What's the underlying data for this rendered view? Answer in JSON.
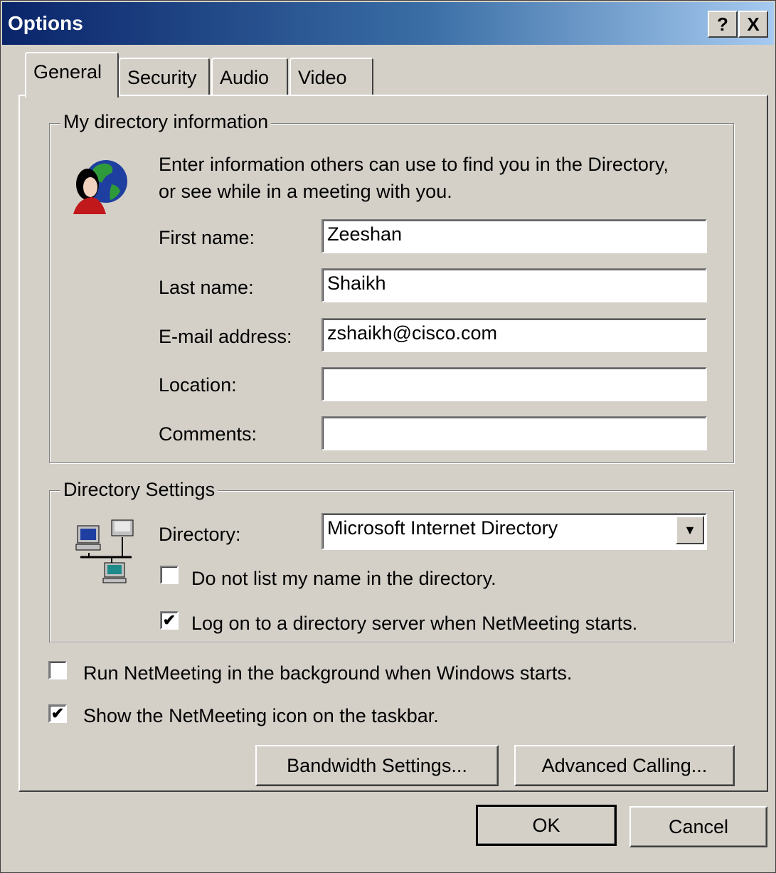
{
  "window": {
    "title": "Options",
    "help_button": "?",
    "close_button": "X"
  },
  "tabs": [
    {
      "label": "General"
    },
    {
      "label": "Security"
    },
    {
      "label": "Audio"
    },
    {
      "label": "Video"
    }
  ],
  "directory_info": {
    "legend": "My directory information",
    "intro_line1": "Enter information others can use to find you in the Directory,",
    "intro_line2": "or see while in a meeting with you.",
    "fields": [
      {
        "label": "First name:",
        "value": "Zeeshan"
      },
      {
        "label": "Last name:",
        "value": "Shaikh"
      },
      {
        "label": "E-mail address:",
        "value": "zshaikh@cisco.com"
      },
      {
        "label": "Location:",
        "value": ""
      },
      {
        "label": "Comments:",
        "value": ""
      }
    ]
  },
  "directory_settings": {
    "legend": "Directory Settings",
    "directory_label": "Directory:",
    "directory_value": "Microsoft Internet Directory",
    "do_not_list_label": "Do not list my name in the directory.",
    "do_not_list_checked": false,
    "logon_label": "Log on to a directory server when NetMeeting starts.",
    "logon_checked": true
  },
  "options": {
    "run_background_label": "Run NetMeeting in the background when Windows starts.",
    "run_background_checked": false,
    "show_icon_label": "Show the NetMeeting icon on the taskbar.",
    "show_icon_checked": true
  },
  "buttons": {
    "bandwidth": "Bandwidth Settings...",
    "advanced_calling": "Advanced Calling...",
    "ok": "OK",
    "cancel": "Cancel"
  },
  "icons": {
    "directory_info": "person-globe-icon",
    "directory_settings": "network-computers-icon",
    "dropdown": "chevron-down-icon"
  }
}
